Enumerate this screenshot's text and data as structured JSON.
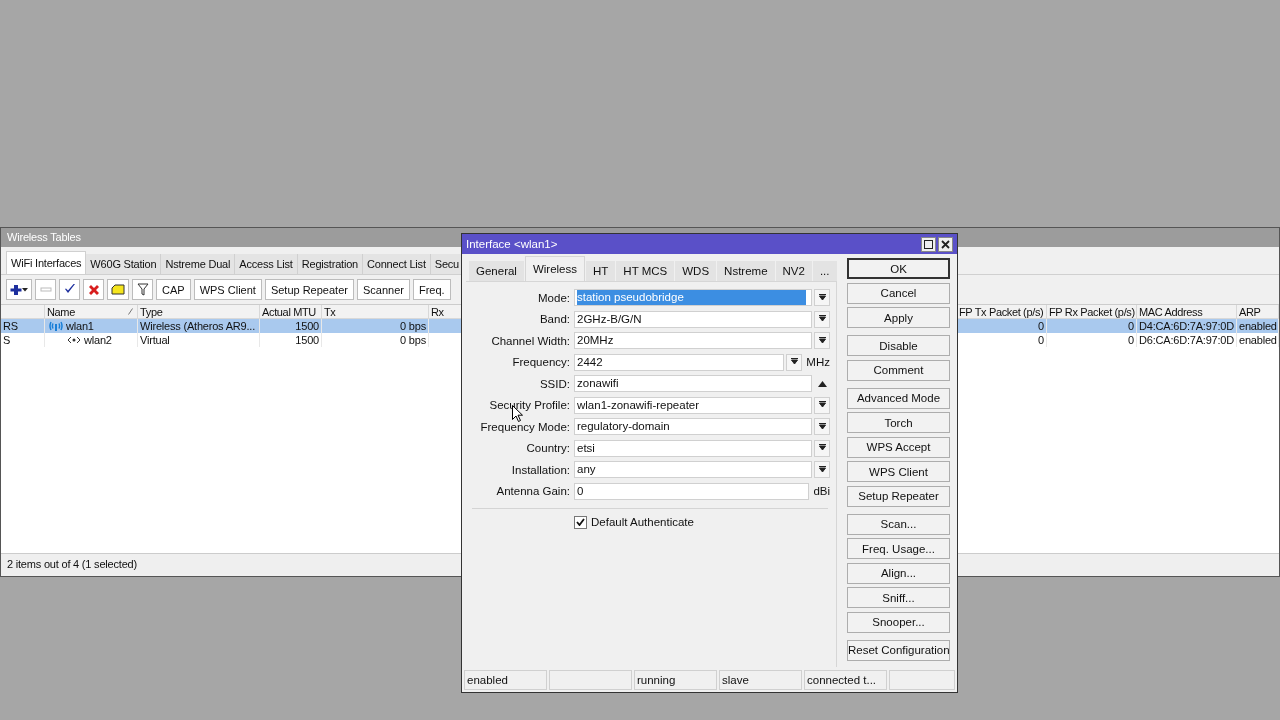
{
  "bg_window": {
    "title": "Wireless Tables",
    "tabs": [
      {
        "label": "WiFi Interfaces",
        "selected": true
      },
      {
        "label": "W60G Station",
        "selected": false
      },
      {
        "label": "Nstreme Dual",
        "selected": false
      },
      {
        "label": "Access List",
        "selected": false
      },
      {
        "label": "Registration",
        "selected": false
      },
      {
        "label": "Connect List",
        "selected": false
      },
      {
        "label": "Secu",
        "selected": false
      }
    ],
    "toolbar_buttons": [
      "CAP",
      "WPS Client",
      "Setup Repeater",
      "Scanner",
      "Freq."
    ],
    "table": {
      "columns": [
        "Name",
        "Type",
        "Actual MTU",
        "Tx",
        "Rx",
        "FP Tx Packet (p/s)",
        "FP Rx Packet (p/s)",
        "MAC Address",
        "ARP"
      ],
      "rows": [
        {
          "flags": "RS",
          "name": "wlan1",
          "kind": "wireless",
          "type": "Wireless (Atheros AR9...",
          "mtu": "1500",
          "tx": "0 bps",
          "fp_tx": "0",
          "fp_rx": "0",
          "mac": "D4:CA:6D:7A:97:0D",
          "arp": "enabled",
          "selected": true,
          "children": [
            {
              "flags": "S",
              "name": "wlan2",
              "kind": "virtual",
              "type": "Virtual",
              "mtu": "1500",
              "tx": "0 bps",
              "fp_tx": "0",
              "fp_rx": "0",
              "mac": "D6:CA:6D:7A:97:0D",
              "arp": "enabled",
              "selected": false
            }
          ]
        }
      ]
    },
    "status": "2 items out of 4 (1 selected)"
  },
  "dialog": {
    "title": "Interface <wlan1>",
    "tabs": [
      {
        "label": "General",
        "selected": false
      },
      {
        "label": "Wireless",
        "selected": true
      },
      {
        "label": "HT",
        "selected": false
      },
      {
        "label": "HT MCS",
        "selected": false
      },
      {
        "label": "WDS",
        "selected": false
      },
      {
        "label": "Nstreme",
        "selected": false
      },
      {
        "label": "NV2",
        "selected": false
      },
      {
        "label": "...",
        "selected": false
      }
    ],
    "fields": [
      {
        "label": "Mode:",
        "value": "station pseudobridge",
        "kind": "dropdown",
        "highlighted": true
      },
      {
        "label": "Band:",
        "value": "2GHz-B/G/N",
        "kind": "dropdown",
        "highlighted": false
      },
      {
        "label": "Channel Width:",
        "value": "20MHz",
        "kind": "dropdown",
        "highlighted": false
      },
      {
        "label": "Frequency:",
        "value": "2442",
        "kind": "dropdown",
        "unit": "MHz",
        "highlighted": false
      },
      {
        "label": "SSID:",
        "value": "zonawifi",
        "kind": "collapse",
        "highlighted": false
      },
      {
        "label": "Security Profile:",
        "value": "wlan1-zonawifi-repeater",
        "kind": "dropdown",
        "highlighted": false
      },
      {
        "label": "Frequency Mode:",
        "value": "regulatory-domain",
        "kind": "dropdown",
        "highlighted": false
      },
      {
        "label": "Country:",
        "value": "etsi",
        "kind": "dropdown",
        "highlighted": false
      },
      {
        "label": "Installation:",
        "value": "any",
        "kind": "dropdown",
        "highlighted": false
      },
      {
        "label": "Antenna Gain:",
        "value": "0",
        "unit": "dBi",
        "highlighted": false
      }
    ],
    "options": [
      {
        "label": "Default Authenticate",
        "checked": true
      }
    ],
    "button_groups": [
      [
        {
          "label": "OK",
          "default": true
        },
        {
          "label": "Cancel",
          "default": false
        },
        {
          "label": "Apply",
          "default": false
        }
      ],
      [
        {
          "label": "Disable",
          "default": false
        },
        {
          "label": "Comment",
          "default": false
        }
      ],
      [
        {
          "label": "Advanced Mode",
          "default": false
        },
        {
          "label": "Torch",
          "default": false
        },
        {
          "label": "WPS Accept",
          "default": false
        },
        {
          "label": "WPS Client",
          "default": false
        },
        {
          "label": "Setup Repeater",
          "default": false
        }
      ],
      [
        {
          "label": "Scan...",
          "default": false
        },
        {
          "label": "Freq. Usage...",
          "default": false
        },
        {
          "label": "Align...",
          "default": false
        },
        {
          "label": "Sniff...",
          "default": false
        },
        {
          "label": "Snooper...",
          "default": false
        }
      ],
      [
        {
          "label": "Reset Configuration",
          "default": false
        }
      ]
    ],
    "status_bar": [
      "enabled",
      "running",
      "slave",
      "connected t..."
    ]
  }
}
